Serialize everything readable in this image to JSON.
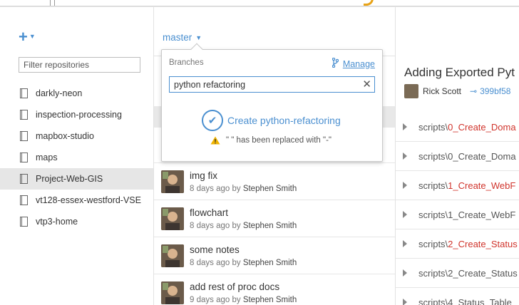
{
  "sidebar": {
    "add_label": "+",
    "filter_placeholder": "Filter repositories",
    "repos": [
      {
        "name": "darkly-neon",
        "selected": false
      },
      {
        "name": "inspection-processing",
        "selected": false
      },
      {
        "name": "mapbox-studio",
        "selected": false
      },
      {
        "name": "maps",
        "selected": false
      },
      {
        "name": "Project-Web-GIS",
        "selected": true
      },
      {
        "name": "vt128-essex-westford-VSE",
        "selected": false
      },
      {
        "name": "vtp3-home",
        "selected": false
      }
    ]
  },
  "branch_selector": {
    "current_branch": "master"
  },
  "popover": {
    "heading": "Branches",
    "manage_label": "Manage",
    "input_value": "python refactoring",
    "create_label": "Create python-refactoring",
    "warning_text": "\" \" has been replaced with \"-\""
  },
  "commits": [
    {
      "title": "img fix",
      "time": "8 days ago by",
      "author": "Stephen Smith"
    },
    {
      "title": "flowchart",
      "time": "8 days ago by",
      "author": "Stephen Smith"
    },
    {
      "title": "some notes",
      "time": "8 days ago by",
      "author": "Stephen Smith"
    },
    {
      "title": "add rest of proc docs",
      "time": "9 days ago by",
      "author": "Stephen Smith"
    }
  ],
  "detail": {
    "title": "Adding Exported Pyt",
    "author": "Rick Scott",
    "sha": "399bf58",
    "files": [
      {
        "path": "scripts\\",
        "name": "0_Create_Doma",
        "changed": true
      },
      {
        "path": "scripts\\",
        "name": "0_Create_Doma",
        "changed": false
      },
      {
        "path": "scripts\\",
        "name": "1_Create_WebF",
        "changed": true
      },
      {
        "path": "scripts\\",
        "name": "1_Create_WebF",
        "changed": false
      },
      {
        "path": "scripts\\",
        "name": "2_Create_Status",
        "changed": true
      },
      {
        "path": "scripts\\",
        "name": "2_Create_Status",
        "changed": false
      },
      {
        "path": "scripts\\",
        "name": "4_Status_Table_",
        "changed": false
      }
    ]
  },
  "colors": {
    "accent": "#4a8fd0",
    "deleted": "#d0342c",
    "warning": "#f0b400"
  }
}
